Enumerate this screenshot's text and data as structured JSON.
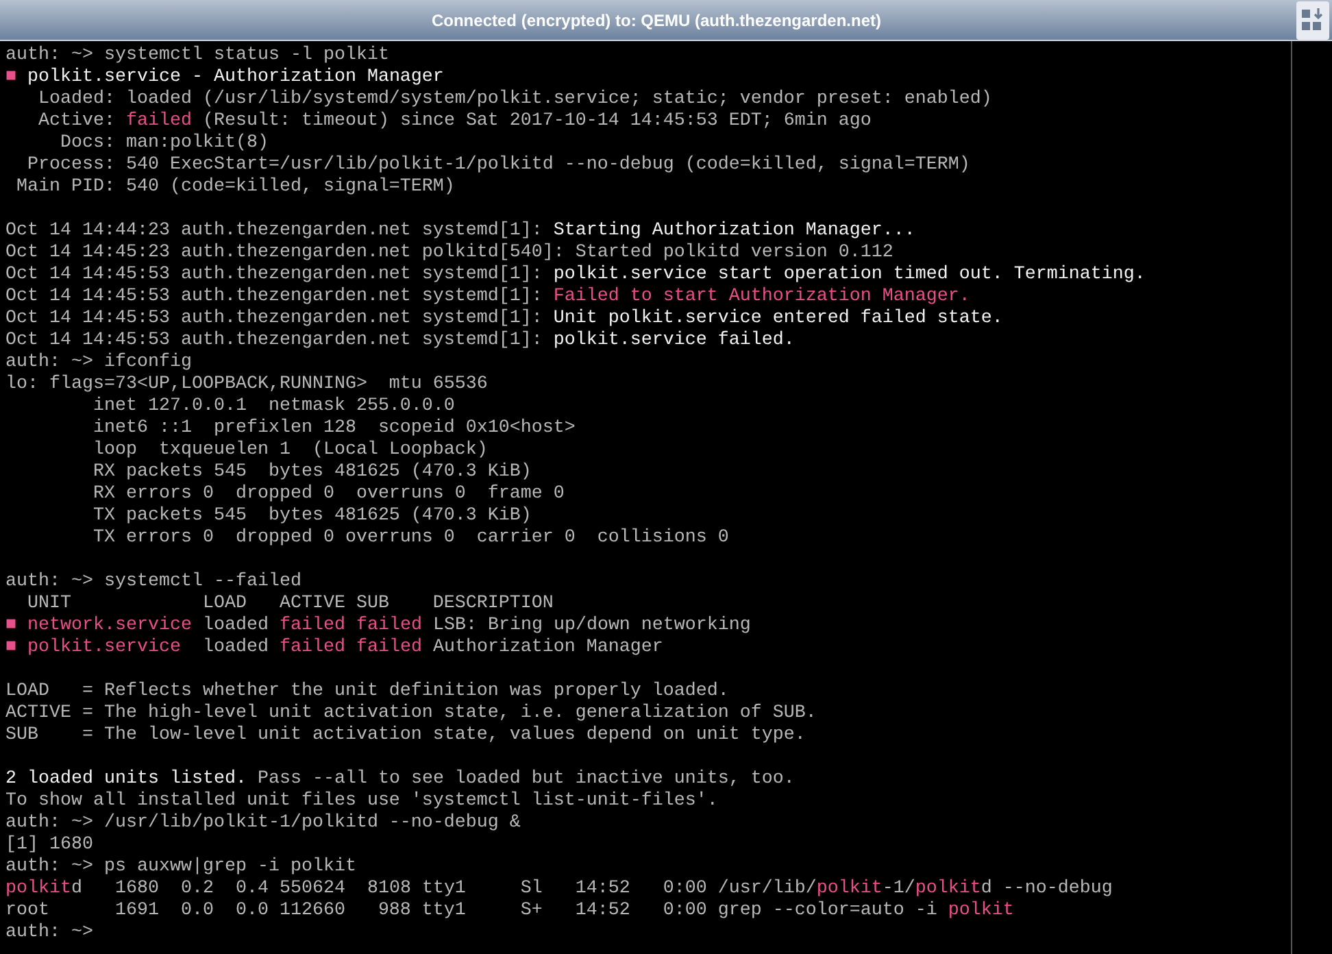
{
  "window": {
    "title": "Connected (encrypted) to: QEMU (auth.thezengarden.net)"
  },
  "terminal": {
    "lines": [
      {
        "kind": "text",
        "segments": [
          {
            "kind": "normal",
            "text": "auth: ~> systemctl status -l polkit"
          }
        ]
      },
      {
        "kind": "text",
        "segments": [
          {
            "kind": "red",
            "text": "■"
          },
          {
            "kind": "bright",
            "text": " polkit.service - Authorization Manager"
          }
        ]
      },
      {
        "kind": "text",
        "segments": [
          {
            "kind": "normal",
            "text": "   Loaded: loaded (/usr/lib/systemd/system/polkit.service; static; vendor preset: enabled)"
          }
        ]
      },
      {
        "kind": "text",
        "segments": [
          {
            "kind": "normal",
            "text": "   Active: "
          },
          {
            "kind": "red",
            "text": "failed"
          },
          {
            "kind": "normal",
            "text": " (Result: timeout) since Sat 2017-10-14 14:45:53 EDT; 6min ago"
          }
        ]
      },
      {
        "kind": "text",
        "segments": [
          {
            "kind": "normal",
            "text": "     Docs: man:polkit(8)"
          }
        ]
      },
      {
        "kind": "text",
        "segments": [
          {
            "kind": "normal",
            "text": "  Process: 540 ExecStart=/usr/lib/polkit-1/polkitd --no-debug (code=killed, signal=TERM)"
          }
        ]
      },
      {
        "kind": "text",
        "segments": [
          {
            "kind": "normal",
            "text": " Main PID: 540 (code=killed, signal=TERM)"
          }
        ]
      },
      {
        "kind": "blank"
      },
      {
        "kind": "text",
        "segments": [
          {
            "kind": "normal",
            "text": "Oct 14 14:44:23 auth.thezengarden.net systemd[1]: "
          },
          {
            "kind": "bright",
            "text": "Starting Authorization Manager..."
          }
        ]
      },
      {
        "kind": "text",
        "segments": [
          {
            "kind": "normal",
            "text": "Oct 14 14:45:23 auth.thezengarden.net polkitd[540]: Started polkitd version 0.112"
          }
        ]
      },
      {
        "kind": "text",
        "segments": [
          {
            "kind": "normal",
            "text": "Oct 14 14:45:53 auth.thezengarden.net systemd[1]: "
          },
          {
            "kind": "bright",
            "text": "polkit.service start operation timed out. Terminating."
          }
        ]
      },
      {
        "kind": "text",
        "segments": [
          {
            "kind": "normal",
            "text": "Oct 14 14:45:53 auth.thezengarden.net systemd[1]: "
          },
          {
            "kind": "red",
            "text": "Failed to start Authorization Manager."
          }
        ]
      },
      {
        "kind": "text",
        "segments": [
          {
            "kind": "normal",
            "text": "Oct 14 14:45:53 auth.thezengarden.net systemd[1]: "
          },
          {
            "kind": "bright",
            "text": "Unit polkit.service entered failed state."
          }
        ]
      },
      {
        "kind": "text",
        "segments": [
          {
            "kind": "normal",
            "text": "Oct 14 14:45:53 auth.thezengarden.net systemd[1]: "
          },
          {
            "kind": "bright",
            "text": "polkit.service failed."
          }
        ]
      },
      {
        "kind": "text",
        "segments": [
          {
            "kind": "normal",
            "text": "auth: ~> ifconfig"
          }
        ]
      },
      {
        "kind": "text",
        "segments": [
          {
            "kind": "normal",
            "text": "lo: flags=73<UP,LOOPBACK,RUNNING>  mtu 65536"
          }
        ]
      },
      {
        "kind": "text",
        "segments": [
          {
            "kind": "normal",
            "text": "        inet 127.0.0.1  netmask 255.0.0.0"
          }
        ]
      },
      {
        "kind": "text",
        "segments": [
          {
            "kind": "normal",
            "text": "        inet6 ::1  prefixlen 128  scopeid 0x10<host>"
          }
        ]
      },
      {
        "kind": "text",
        "segments": [
          {
            "kind": "normal",
            "text": "        loop  txqueuelen 1  (Local Loopback)"
          }
        ]
      },
      {
        "kind": "text",
        "segments": [
          {
            "kind": "normal",
            "text": "        RX packets 545  bytes 481625 (470.3 KiB)"
          }
        ]
      },
      {
        "kind": "text",
        "segments": [
          {
            "kind": "normal",
            "text": "        RX errors 0  dropped 0  overruns 0  frame 0"
          }
        ]
      },
      {
        "kind": "text",
        "segments": [
          {
            "kind": "normal",
            "text": "        TX packets 545  bytes 481625 (470.3 KiB)"
          }
        ]
      },
      {
        "kind": "text",
        "segments": [
          {
            "kind": "normal",
            "text": "        TX errors 0  dropped 0 overruns 0  carrier 0  collisions 0"
          }
        ]
      },
      {
        "kind": "blank"
      },
      {
        "kind": "text",
        "segments": [
          {
            "kind": "normal",
            "text": "auth: ~> systemctl --failed"
          }
        ]
      },
      {
        "kind": "text",
        "segments": [
          {
            "kind": "normal",
            "text": "  UNIT            LOAD   ACTIVE SUB    DESCRIPTION"
          }
        ]
      },
      {
        "kind": "text",
        "segments": [
          {
            "kind": "red",
            "text": "■ network.service"
          },
          {
            "kind": "normal",
            "text": " loaded "
          },
          {
            "kind": "red",
            "text": "failed failed"
          },
          {
            "kind": "normal",
            "text": " LSB: Bring up/down networking"
          }
        ]
      },
      {
        "kind": "text",
        "segments": [
          {
            "kind": "red",
            "text": "■ polkit.service"
          },
          {
            "kind": "normal",
            "text": "  loaded "
          },
          {
            "kind": "red",
            "text": "failed failed"
          },
          {
            "kind": "normal",
            "text": " Authorization Manager"
          }
        ]
      },
      {
        "kind": "blank"
      },
      {
        "kind": "text",
        "segments": [
          {
            "kind": "normal",
            "text": "LOAD   = Reflects whether the unit definition was properly loaded."
          }
        ]
      },
      {
        "kind": "text",
        "segments": [
          {
            "kind": "normal",
            "text": "ACTIVE = The high-level unit activation state, i.e. generalization of SUB."
          }
        ]
      },
      {
        "kind": "text",
        "segments": [
          {
            "kind": "normal",
            "text": "SUB    = The low-level unit activation state, values depend on unit type."
          }
        ]
      },
      {
        "kind": "blank"
      },
      {
        "kind": "text",
        "segments": [
          {
            "kind": "bright",
            "text": "2 loaded units listed."
          },
          {
            "kind": "normal",
            "text": " Pass --all to see loaded but inactive units, too."
          }
        ]
      },
      {
        "kind": "text",
        "segments": [
          {
            "kind": "normal",
            "text": "To show all installed unit files use 'systemctl list-unit-files'."
          }
        ]
      },
      {
        "kind": "text",
        "segments": [
          {
            "kind": "normal",
            "text": "auth: ~> /usr/lib/polkit-1/polkitd --no-debug &"
          }
        ]
      },
      {
        "kind": "text",
        "segments": [
          {
            "kind": "normal",
            "text": "[1] 1680"
          }
        ]
      },
      {
        "kind": "text",
        "segments": [
          {
            "kind": "normal",
            "text": "auth: ~> ps auxww|grep -i polkit"
          }
        ]
      },
      {
        "kind": "text",
        "segments": [
          {
            "kind": "red",
            "text": "polkit"
          },
          {
            "kind": "normal",
            "text": "d   1680  0.2  0.4 550624  8108 tty1     Sl   14:52   0:00 /usr/lib/"
          },
          {
            "kind": "red",
            "text": "polkit"
          },
          {
            "kind": "normal",
            "text": "-1/"
          },
          {
            "kind": "red",
            "text": "polkit"
          },
          {
            "kind": "normal",
            "text": "d --no-debug"
          }
        ]
      },
      {
        "kind": "text",
        "segments": [
          {
            "kind": "normal",
            "text": "root      1691  0.0  0.0 112660   988 tty1     S+   14:52   0:00 grep --color=auto -i "
          },
          {
            "kind": "red",
            "text": "polkit"
          }
        ]
      },
      {
        "kind": "text",
        "segments": [
          {
            "kind": "normal",
            "text": "auth: ~>"
          }
        ]
      }
    ]
  }
}
